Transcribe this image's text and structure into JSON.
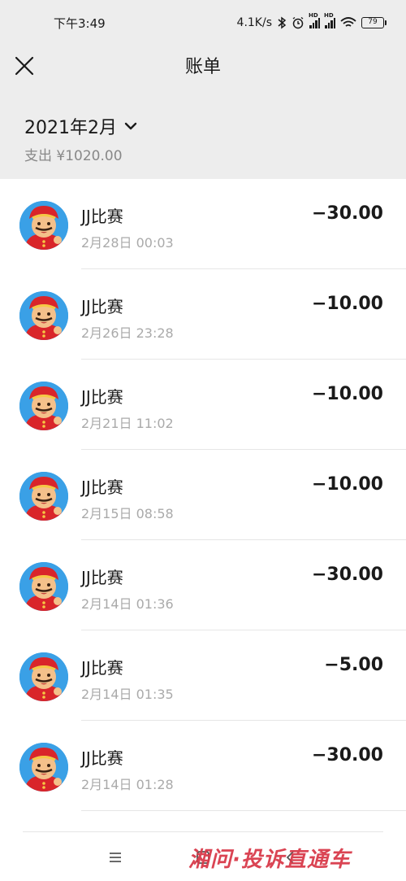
{
  "status_bar": {
    "time": "下午3:49",
    "speed": "4.1K/s",
    "hd_label": "HD",
    "battery": "79"
  },
  "nav": {
    "title": "账单"
  },
  "header": {
    "month": "2021年2月",
    "summary": "支出 ¥1020.00"
  },
  "transactions": [
    {
      "name": "JJ比赛",
      "time": "2月28日 00:03",
      "amount": "−30.00"
    },
    {
      "name": "JJ比赛",
      "time": "2月26日 23:28",
      "amount": "−10.00"
    },
    {
      "name": "JJ比赛",
      "time": "2月21日 11:02",
      "amount": "−10.00"
    },
    {
      "name": "JJ比赛",
      "time": "2月15日 08:58",
      "amount": "−10.00"
    },
    {
      "name": "JJ比赛",
      "time": "2月14日 01:36",
      "amount": "−30.00"
    },
    {
      "name": "JJ比赛",
      "time": "2月14日 01:35",
      "amount": "−5.00"
    },
    {
      "name": "JJ比赛",
      "time": "2月14日 01:28",
      "amount": "−30.00"
    }
  ],
  "watermark": "湘问·投诉直通车",
  "colors": {
    "header_bg": "#ededed",
    "watermark": "#d93a4a",
    "avatar_bg": "#3aa0e6"
  }
}
